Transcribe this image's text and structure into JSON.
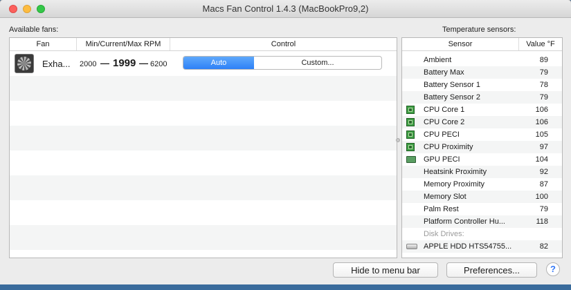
{
  "window": {
    "title": "Macs Fan Control 1.4.3 (MacBookPro9,2)"
  },
  "fans_panel": {
    "label": "Available fans:",
    "headers": {
      "fan": "Fan",
      "rpm": "Min/Current/Max RPM",
      "control": "Control"
    },
    "fans": [
      {
        "name": "Exha...",
        "min": "2000",
        "dash": "—",
        "current": "1999",
        "max": "6200",
        "auto_label": "Auto",
        "custom_label": "Custom..."
      }
    ]
  },
  "sensors_panel": {
    "label": "Temperature sensors:",
    "headers": {
      "sensor": "Sensor",
      "value": "Value °F"
    },
    "sensors": [
      {
        "name": "Ambient",
        "value": "89",
        "icon": ""
      },
      {
        "name": "Battery Max",
        "value": "79",
        "icon": ""
      },
      {
        "name": "Battery Sensor 1",
        "value": "78",
        "icon": ""
      },
      {
        "name": "Battery Sensor 2",
        "value": "79",
        "icon": ""
      },
      {
        "name": "CPU Core 1",
        "value": "106",
        "icon": "cpu-chip-icon"
      },
      {
        "name": "CPU Core 2",
        "value": "106",
        "icon": "cpu-chip-icon"
      },
      {
        "name": "CPU PECI",
        "value": "105",
        "icon": "cpu-chip-icon"
      },
      {
        "name": "CPU Proximity",
        "value": "97",
        "icon": "cpu-chip-icon"
      },
      {
        "name": "GPU PECI",
        "value": "104",
        "icon": "gpu-card-icon"
      },
      {
        "name": "Heatsink Proximity",
        "value": "92",
        "icon": ""
      },
      {
        "name": "Memory Proximity",
        "value": "87",
        "icon": ""
      },
      {
        "name": "Memory Slot",
        "value": "100",
        "icon": ""
      },
      {
        "name": "Palm Rest",
        "value": "79",
        "icon": ""
      },
      {
        "name": "Platform Controller Hu...",
        "value": "118",
        "icon": ""
      }
    ],
    "disk_group_label": "Disk Drives:",
    "disks": [
      {
        "name": "APPLE HDD HTS54755...",
        "value": "82",
        "icon": "hard-drive-icon"
      }
    ]
  },
  "buttons": {
    "hide_label": "Hide to menu bar",
    "prefs_label": "Preferences...",
    "help_label": "?"
  },
  "colors": {
    "accent": "#2d81f7",
    "chip_green": "#3e9e45"
  }
}
